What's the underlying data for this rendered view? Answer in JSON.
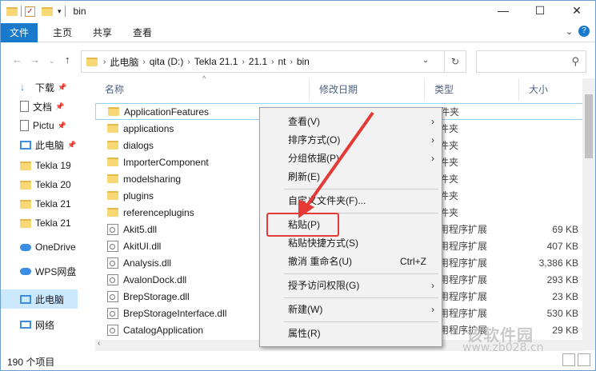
{
  "window": {
    "title": "bin",
    "minimize": "—",
    "maximize": "☐",
    "close": "✕",
    "help": "?"
  },
  "ribbon": {
    "tabs": [
      "文件",
      "主页",
      "共享",
      "查看"
    ],
    "expand": "⌄"
  },
  "address": {
    "crumbs": [
      "此电脑",
      "qita (D:)",
      "Tekla 21.1",
      "21.1",
      "nt",
      "bin"
    ],
    "search_placeholder": ""
  },
  "nav": {
    "items": [
      {
        "label": "下载",
        "icon": "download-icon",
        "pinned": true
      },
      {
        "label": "文档",
        "icon": "document-icon",
        "pinned": true
      },
      {
        "label": "Pictu",
        "icon": "pictures-icon",
        "pinned": true
      },
      {
        "label": "此电脑",
        "icon": "computer-icon",
        "pinned": true
      },
      {
        "label": "Tekla 19",
        "icon": "folder-icon"
      },
      {
        "label": "Tekla 20",
        "icon": "folder-icon"
      },
      {
        "label": "Tekla 21",
        "icon": "folder-icon"
      },
      {
        "label": "Tekla 21",
        "icon": "folder-icon"
      },
      {
        "label": "OneDrive",
        "icon": "cloud-icon"
      },
      {
        "label": "WPS网盘",
        "icon": "cloud-icon"
      },
      {
        "label": "此电脑",
        "icon": "computer-icon",
        "selected": true
      },
      {
        "label": "网络",
        "icon": "network-icon"
      }
    ]
  },
  "columns": {
    "name": "名称",
    "date": "修改日期",
    "type": "类型",
    "size": "大小"
  },
  "files": [
    {
      "name": "ApplicationFeatures",
      "type": "件夹",
      "size": "",
      "kind": "folder"
    },
    {
      "name": "applications",
      "type": "件夹",
      "size": "",
      "kind": "folder"
    },
    {
      "name": "dialogs",
      "type": "件夹",
      "size": "",
      "kind": "folder"
    },
    {
      "name": "ImporterComponent",
      "type": "件夹",
      "size": "",
      "kind": "folder"
    },
    {
      "name": "modelsharing",
      "type": "件夹",
      "size": "",
      "kind": "folder"
    },
    {
      "name": "plugins",
      "type": "件夹",
      "size": "",
      "kind": "folder"
    },
    {
      "name": "referenceplugins",
      "type": "件夹",
      "size": "",
      "kind": "folder"
    },
    {
      "name": "Akit5.dll",
      "type": "用程序扩展",
      "size": "69 KB",
      "kind": "dll"
    },
    {
      "name": "AkitUI.dll",
      "type": "用程序扩展",
      "size": "407 KB",
      "kind": "dll"
    },
    {
      "name": "Analysis.dll",
      "type": "用程序扩展",
      "size": "3,386 KB",
      "kind": "dll"
    },
    {
      "name": "AvalonDock.dll",
      "type": "用程序扩展",
      "size": "293 KB",
      "kind": "dll"
    },
    {
      "name": "BrepStorage.dll",
      "type": "用程序扩展",
      "size": "23 KB",
      "kind": "dll"
    },
    {
      "name": "BrepStorageInterface.dll",
      "type": "用程序扩展",
      "size": "530 KB",
      "kind": "dll"
    },
    {
      "name": "CatalogApplication",
      "type": "用程序扩展",
      "size": "29 KB",
      "kind": "dll"
    }
  ],
  "context_menu": [
    {
      "label": "查看(V)",
      "submenu": true
    },
    {
      "label": "排序方式(O)",
      "submenu": true
    },
    {
      "label": "分组依据(P)",
      "submenu": true
    },
    {
      "label": "刷新(E)"
    },
    {
      "sep": true
    },
    {
      "label": "自定义文件夹(F)..."
    },
    {
      "sep": true
    },
    {
      "label": "粘贴(P)"
    },
    {
      "label": "粘贴快捷方式(S)"
    },
    {
      "label": "撤消 重命名(U)",
      "shortcut": "Ctrl+Z"
    },
    {
      "sep": true
    },
    {
      "label": "授予访问权限(G)",
      "submenu": true
    },
    {
      "sep": true
    },
    {
      "label": "新建(W)",
      "submenu": true
    },
    {
      "sep": true
    },
    {
      "label": "属性(R)"
    }
  ],
  "status": {
    "count": "190 个项目"
  },
  "watermark": {
    "line1": "该软件园",
    "line2": "www.zb028.cn"
  },
  "colors": {
    "accent": "#1979ca",
    "selection": "#cce8ff",
    "highlight_box": "#e53935",
    "arrow": "#e53935",
    "folder": "#f8d775"
  }
}
